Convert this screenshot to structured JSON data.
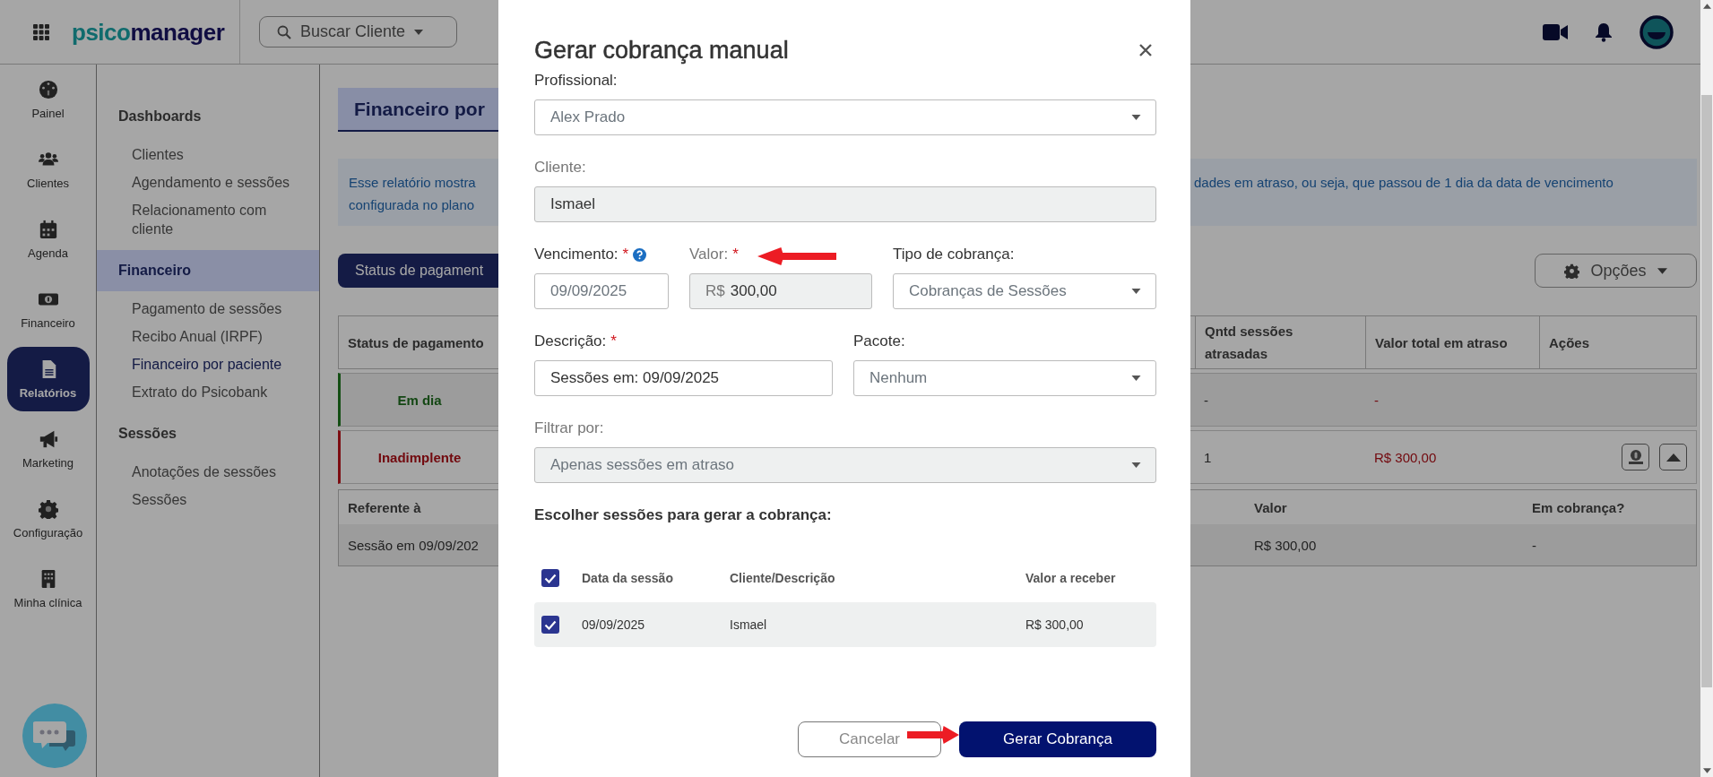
{
  "topbar": {
    "logo": {
      "lead": "psico",
      "rest": "manager"
    },
    "search": {
      "placeholder": "Buscar Cliente"
    }
  },
  "rail": [
    {
      "label": "Painel",
      "selected": false
    },
    {
      "label": "Clientes",
      "selected": false
    },
    {
      "label": "Agenda",
      "selected": false
    },
    {
      "label": "Financeiro",
      "selected": false
    },
    {
      "label": "Relatórios",
      "selected": true
    },
    {
      "label": "Marketing",
      "selected": false
    },
    {
      "label": "Configuração",
      "selected": false
    },
    {
      "label": "Minha clínica",
      "selected": false
    }
  ],
  "menu": [
    {
      "heading": "Dashboards",
      "selected": false,
      "items": [
        {
          "label": "Clientes",
          "selected": false
        },
        {
          "label": "Agendamento e sessões",
          "selected": false
        },
        {
          "label": "Relacionamento com cliente",
          "selected": false
        }
      ]
    },
    {
      "heading": "Financeiro",
      "selected": true,
      "items": [
        {
          "label": "Pagamento de sessões",
          "selected": false
        },
        {
          "label": "Recibo Anual (IRPF)",
          "selected": false
        },
        {
          "label": "Financeiro por paciente",
          "selected": true
        },
        {
          "label": "Extrato do Psicobank",
          "selected": false
        }
      ]
    },
    {
      "heading": "Sessões",
      "selected": false,
      "items": [
        {
          "label": "Anotações de sessões",
          "selected": false
        },
        {
          "label": "Sessões",
          "selected": false
        }
      ]
    }
  ],
  "page": {
    "title": "Financeiro por",
    "info_left": [
      "Esse relatório mostra",
      "configurada no plano"
    ],
    "info_right": [
      "dades em atraso, ou seja, que passou de 1 dia da data de vencimento"
    ],
    "tab": "Status de pagament",
    "options": "Opções",
    "table": {
      "columns_left": [
        "Status de pagamento"
      ],
      "columns_right": [
        "Qntd sessões atrasadas",
        "Valor total em atraso",
        "Ações"
      ],
      "rows": [
        {
          "kind": "paid",
          "status": "Em dia",
          "late_sessions": "-",
          "late_total": "-",
          "actions": false
        },
        {
          "kind": "overdue",
          "status": "Inadimplente",
          "late_sessions": "1",
          "late_total": "R$ 300,00",
          "actions": true
        }
      ],
      "detail": {
        "columns_left": [
          "Referente à"
        ],
        "columns_right": [
          "Valor",
          "Em cobrança?"
        ],
        "rows": [
          {
            "left": "Sessão em 09/09/202",
            "right": [
              "R$ 300,00",
              "-"
            ]
          }
        ]
      }
    }
  },
  "modal": {
    "title": "Gerar cobrança manual",
    "rows": [
      [
        {
          "label": "Profissional:",
          "kind": "select",
          "value": "Alex Prado",
          "disabled": false
        }
      ],
      [
        {
          "label": "Cliente:",
          "kind": "text",
          "value": "Ismael",
          "disabled": true
        }
      ],
      [
        {
          "label": "Vencimento:",
          "mark": "*",
          "help": true,
          "kind": "date",
          "value": "09/09/2025",
          "disabled": false
        },
        {
          "label": "Valor:",
          "mark": "*",
          "kind": "money",
          "prefix": "R$",
          "value": "300,00",
          "disabled": true
        },
        {
          "label": "Tipo de cobrança:",
          "kind": "select",
          "value": "Cobranças de Sessões",
          "disabled": false
        }
      ],
      [
        {
          "label": "Descrição:",
          "mark": "*",
          "kind": "text",
          "value": "Sessões em: 09/09/2025",
          "disabled": false
        },
        {
          "label": "Pacote:",
          "kind": "select",
          "value": "Nenhum",
          "disabled": false
        }
      ],
      [
        {
          "label": "Filtrar por:",
          "kind": "select",
          "value": "Apenas sessões em atraso",
          "disabled": true
        }
      ]
    ],
    "sessions": {
      "title": "Escolher sessões para gerar a cobrança:",
      "all_checked": true,
      "columns": [
        "Data da sessão",
        "Cliente/Descrição",
        "Valor a receber"
      ],
      "rows": [
        {
          "checked": true,
          "cells": [
            "09/09/2025",
            "Ismael",
            "R$ 300,00"
          ]
        }
      ]
    },
    "buttons": {
      "cancel": "Cancelar",
      "submit": "Gerar Cobrança"
    }
  },
  "annotations": [
    {
      "kind": "left-arrow"
    },
    {
      "kind": "right-arrow"
    }
  ]
}
